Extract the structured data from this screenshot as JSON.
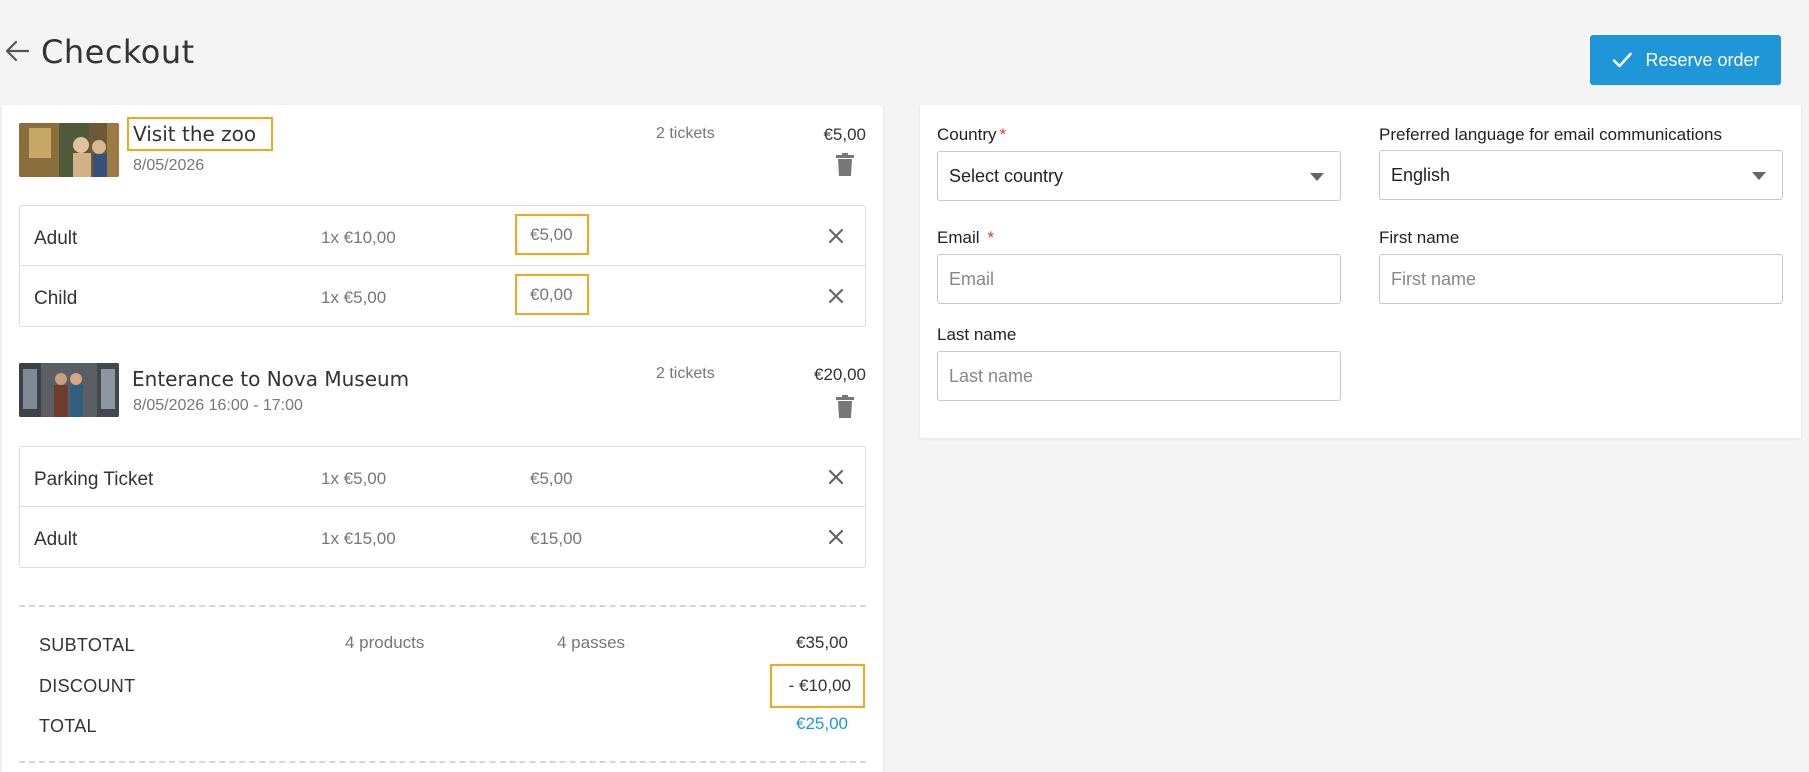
{
  "header": {
    "title": "Checkout",
    "reserve_label": "Reserve order"
  },
  "products": [
    {
      "name": "Visit the zoo",
      "date": "8/05/2026",
      "tickets": "2 tickets",
      "price": "€5,00",
      "lines": [
        {
          "name": "Adult",
          "unit": "1x €10,00",
          "total": "€5,00"
        },
        {
          "name": "Child",
          "unit": "1x €5,00",
          "total": "€0,00"
        }
      ]
    },
    {
      "name": "Enterance to Nova Museum",
      "date": "8/05/2026 16:00 - 17:00",
      "tickets": "2 tickets",
      "price": "€20,00",
      "lines": [
        {
          "name": "Parking Ticket",
          "unit": "1x €5,00",
          "total": "€5,00"
        },
        {
          "name": "Adult",
          "unit": "1x €15,00",
          "total": "€15,00"
        }
      ]
    }
  ],
  "summary": {
    "subtotal_label": "SUBTOTAL",
    "products_count": "4 products",
    "passes_count": "4 passes",
    "subtotal_value": "€35,00",
    "discount_label": "DISCOUNT",
    "discount_value": "- €10,00",
    "total_label": "TOTAL",
    "total_value": "€25,00"
  },
  "form": {
    "country": {
      "label": "Country",
      "value": "Select country"
    },
    "language": {
      "label": "Preferred language for email communications",
      "value": "English"
    },
    "email": {
      "label": "Email",
      "placeholder": "Email"
    },
    "first_name": {
      "label": "First name",
      "placeholder": "First name"
    },
    "last_name": {
      "label": "Last name",
      "placeholder": "Last name"
    }
  },
  "colors": {
    "accent": "#1e96d7",
    "highlight": "#f2a81d",
    "required": "#ee3333"
  }
}
